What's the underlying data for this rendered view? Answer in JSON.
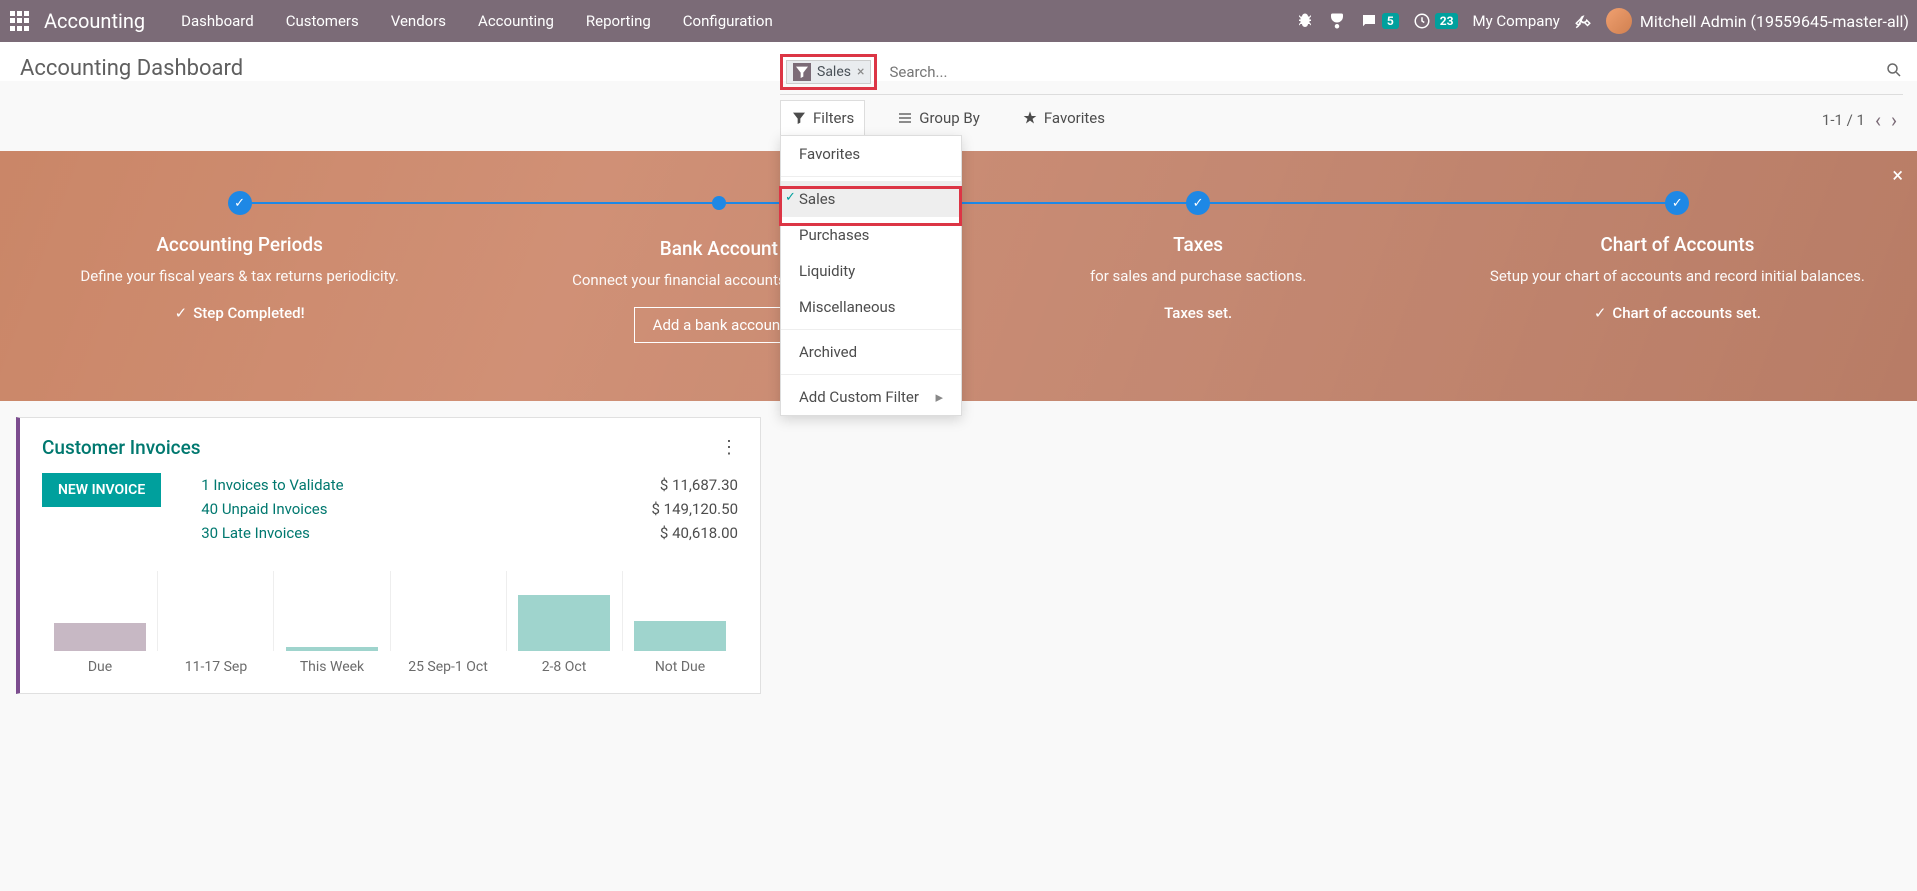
{
  "navbar": {
    "brand": "Accounting",
    "menu": [
      "Dashboard",
      "Customers",
      "Vendors",
      "Accounting",
      "Reporting",
      "Configuration"
    ],
    "messages_badge": "5",
    "activities_badge": "23",
    "company": "My Company",
    "user": "Mitchell Admin (19559645-master-all)"
  },
  "page": {
    "title": "Accounting Dashboard",
    "search_placeholder": "Search...",
    "pager": "1-1 / 1"
  },
  "filter_chip": {
    "label": "Sales"
  },
  "tabs": {
    "filters": "Filters",
    "groupby": "Group By",
    "favorites": "Favorites"
  },
  "dropdown": {
    "favorites": "Favorites",
    "sales": "Sales",
    "purchases": "Purchases",
    "liquidity": "Liquidity",
    "misc": "Miscellaneous",
    "archived": "Archived",
    "custom": "Add Custom Filter"
  },
  "onboarding": {
    "steps": [
      {
        "title": "Accounting Periods",
        "desc": "Define your fiscal years & tax returns periodicity.",
        "status": "Step Completed!"
      },
      {
        "title": "Bank Account",
        "desc": "Connect your financial accounts in seconds.",
        "btn": "Add a bank account"
      },
      {
        "title": "Taxes",
        "desc": "for sales and purchase sactions.",
        "status": "Taxes set."
      },
      {
        "title": "Chart of Accounts",
        "desc": "Setup your chart of accounts and record initial balances.",
        "status": "Chart of accounts set."
      }
    ]
  },
  "card": {
    "title": "Customer Invoices",
    "new_btn": "NEW INVOICE",
    "stats": [
      {
        "label": "1 Invoices to Validate",
        "val": "$ 11,687.30"
      },
      {
        "label": "40 Unpaid Invoices",
        "val": "$ 149,120.50"
      },
      {
        "label": "30 Late Invoices",
        "val": "$ 40,618.00"
      }
    ]
  },
  "chart_data": {
    "type": "bar",
    "categories": [
      "Due",
      "11-17 Sep",
      "This Week",
      "25 Sep-1 Oct",
      "2-8 Oct",
      "Not Due"
    ],
    "values": [
      28,
      0,
      4,
      0,
      56,
      30
    ],
    "colors": [
      "#c7b8c4",
      "#9fd4cd",
      "#9fd4cd",
      "#9fd4cd",
      "#9fd4cd",
      "#9fd4cd"
    ],
    "ylim": [
      0,
      60
    ]
  }
}
